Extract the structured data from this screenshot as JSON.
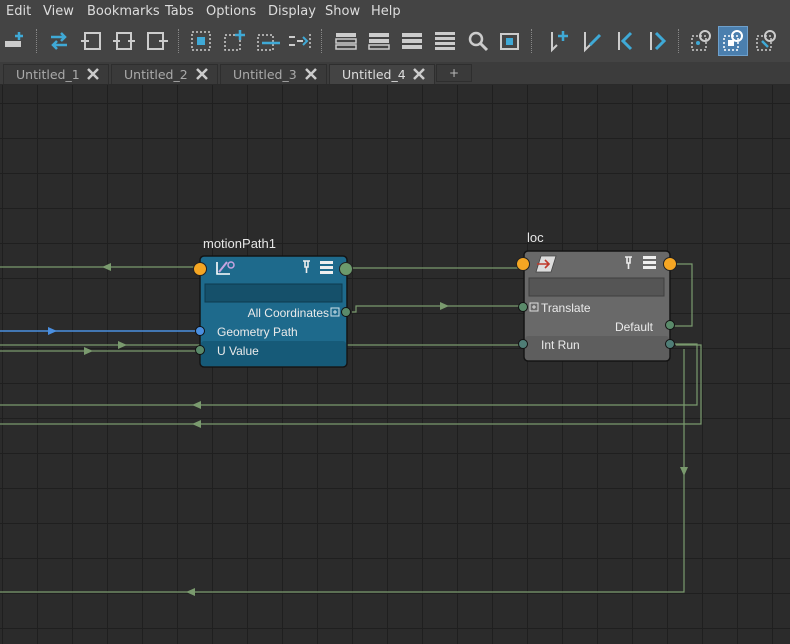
{
  "menu": [
    "Edit",
    "View",
    "Bookmarks",
    "Tabs",
    "Options",
    "Display",
    "Show",
    "Help"
  ],
  "toolbar_icons": [
    "add-node-icon",
    "swap-arrows-icon",
    "input-connections-icon",
    "input-output-connections-icon",
    "output-connections-icon",
    "frame-all-icon",
    "add-selected-icon",
    "remove-selected-icon",
    "graph-layout-icon",
    "simple-mode-icon",
    "connected-mode-icon",
    "full-mode-icon",
    "custom-mode-icon",
    "search-icon",
    "frame-selected-icon",
    "bookmark-add-icon",
    "edit-bookmark-icon",
    "previous-bookmark-icon",
    "next-bookmark-icon",
    "toggle-attribute-filter-icon",
    "show-shapes-icon",
    "show-transforms-icon"
  ],
  "tabs": [
    {
      "label": "Untitled_1"
    },
    {
      "label": "Untitled_2"
    },
    {
      "label": "Untitled_3"
    },
    {
      "label": "Untitled_4",
      "active": true
    }
  ],
  "add_tab_label": "+",
  "nodes": {
    "motionPath": {
      "title": "motionPath1",
      "color": "#1e6a8c",
      "attributes": [
        "All Coordinates",
        "Geometry Path",
        "U Value"
      ]
    },
    "loc": {
      "title": "loc",
      "color": "#696969",
      "attributes": [
        "Translate",
        "Default",
        "Int Run"
      ]
    }
  },
  "colors": {
    "connection": "#7a9a6e",
    "geometry_connection": "#4a8fe0",
    "port_message": "#f5a623",
    "port_default": "#5a8a6a",
    "accent": "#4b7fae"
  }
}
